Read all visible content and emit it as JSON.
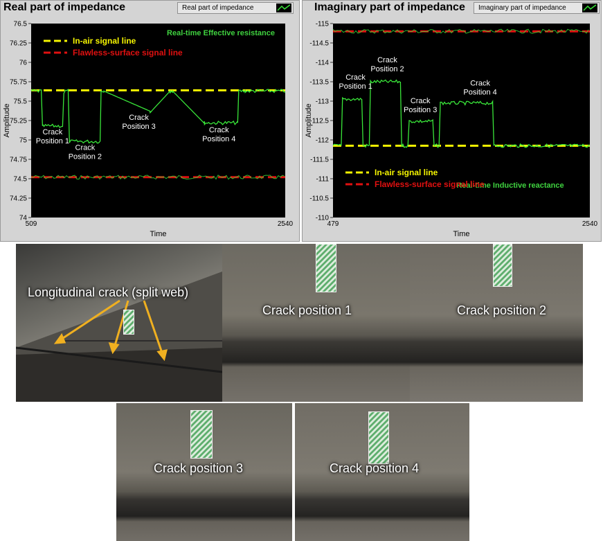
{
  "colors": {
    "signal": "#39e639",
    "in_air_line": "#f5f500",
    "flawless_line": "#e01010",
    "plot_bg": "#000000",
    "legend_green_text": "#3fd23f",
    "legend_yellow_text": "#f5f500",
    "legend_red_text": "#e01010"
  },
  "chart_data": [
    {
      "type": "line",
      "title": "Real part of impedance",
      "legend_label": "Real part of impedance",
      "xlabel": "Time",
      "ylabel": "Amplitude",
      "xlim": [
        509,
        2540
      ],
      "ylim": [
        74,
        76.5
      ],
      "x_tick_labels": [
        "509",
        "2540"
      ],
      "y_ticks": [
        74,
        74.25,
        74.5,
        74.75,
        75,
        75.25,
        75.5,
        75.75,
        76,
        76.25,
        76.5
      ],
      "y_tick_labels": [
        "74",
        "74.25",
        "74.5",
        "74.75",
        "75",
        "75.25",
        "75.5",
        "75.75",
        "76",
        "76.25",
        "76.5"
      ],
      "annotation": "Real-time Effective resistance",
      "series": [
        {
          "name": "In-air signal line",
          "style": "dashed",
          "color": "#f5f500",
          "x": [
            509,
            2540
          ],
          "values": [
            75.64,
            75.64
          ]
        },
        {
          "name": "Flawless-surface signal line",
          "style": "dashed",
          "color": "#e01010",
          "x": [
            509,
            2540
          ],
          "values": [
            74.52,
            74.52
          ]
        },
        {
          "name": "signal",
          "style": "solid",
          "color": "#39e639",
          "x": [
            509,
            590,
            600,
            760,
            770,
            780,
            805,
            815,
            1060,
            1068,
            1090,
            1460,
            1470,
            1620,
            1640,
            1890,
            1895,
            2160,
            2168,
            2220,
            2540
          ],
          "values": [
            75.63,
            75.63,
            75.18,
            75.18,
            75.6,
            75.63,
            75.63,
            74.98,
            74.98,
            75.63,
            75.63,
            75.37,
            75.37,
            75.63,
            75.63,
            75.22,
            75.22,
            75.22,
            75.63,
            75.63,
            75.63
          ]
        }
      ],
      "crack_labels": [
        {
          "text": "Crack Position 1",
          "x": 680,
          "y": 75.07
        },
        {
          "text": "Crack Position 2",
          "x": 940,
          "y": 74.87
        },
        {
          "text": "Crack Position 3",
          "x": 1370,
          "y": 75.26
        },
        {
          "text": "Crack Position 4",
          "x": 2010,
          "y": 75.1
        }
      ],
      "legend_entries": [
        {
          "text": "In-air signal line",
          "color": "#f5f500"
        },
        {
          "text": "Flawless-surface signal line",
          "color": "#e01010"
        }
      ],
      "legend_entries_text": [
        "In-air signal line",
        "Flawless-surface signal line"
      ]
    },
    {
      "type": "line",
      "title": "Imaginary part of impedance",
      "legend_label": "Imaginary part of impedance",
      "xlabel": "Time",
      "ylabel": "Amplitude",
      "xlim": [
        479,
        2540
      ],
      "ylim": [
        -115,
        -110
      ],
      "y_reversed": true,
      "x_tick_labels": [
        "479",
        "2540"
      ],
      "y_ticks": [
        -115,
        -114.5,
        -114,
        -113.5,
        -113,
        -112.5,
        -112,
        -111.5,
        -111,
        -110.5,
        -110
      ],
      "y_tick_labels": [
        "-115",
        "-114.5",
        "-114",
        "-113.5",
        "-113",
        "-112.5",
        "-112",
        "-111.5",
        "-111",
        "-110.5",
        "-110"
      ],
      "annotation": "Real-time Inductive reactance",
      "series": [
        {
          "name": "In-air signal line",
          "style": "dashed",
          "color": "#f5f500",
          "x": [
            479,
            2540
          ],
          "values": [
            -111.85,
            -111.85
          ]
        },
        {
          "name": "Flawless-surface signal line",
          "style": "dashed",
          "color": "#e01010",
          "x": [
            479,
            2540
          ],
          "values": [
            -114.8,
            -114.8
          ]
        },
        {
          "name": "signal",
          "style": "solid",
          "color": "#39e639",
          "x": [
            479,
            545,
            555,
            710,
            720,
            770,
            780,
            1020,
            1030,
            1080,
            1090,
            1280,
            1290,
            1330,
            1340,
            1760,
            1770,
            2540
          ],
          "values": [
            -111.85,
            -111.85,
            -113.05,
            -113.05,
            -111.85,
            -111.85,
            -113.5,
            -113.5,
            -111.85,
            -111.85,
            -112.48,
            -112.48,
            -111.85,
            -111.85,
            -112.95,
            -112.95,
            -111.85,
            -111.85
          ]
        }
      ],
      "crack_labels": [
        {
          "text": "Crack Position 1",
          "x": 660,
          "y": -113.55
        },
        {
          "text": "Crack Position 2",
          "x": 915,
          "y": -114.0
        },
        {
          "text": "Crack Position 3",
          "x": 1180,
          "y": -112.95
        },
        {
          "text": "Crack Position 4",
          "x": 1660,
          "y": -113.4
        }
      ],
      "legend_entries": [
        {
          "text": "In-air signal line",
          "color": "#f5f500"
        },
        {
          "text": "Flawless-surface signal line",
          "color": "#e01010"
        }
      ],
      "legend_entries_text": [
        "In-air signal line",
        "Flawless-surface signal line"
      ]
    }
  ],
  "photos": [
    {
      "caption": "Longitudinal crack (split web)"
    },
    {
      "caption": "Crack position 1"
    },
    {
      "caption": "Crack position 2"
    },
    {
      "caption": "Crack position 3"
    },
    {
      "caption": "Crack position 4"
    }
  ]
}
